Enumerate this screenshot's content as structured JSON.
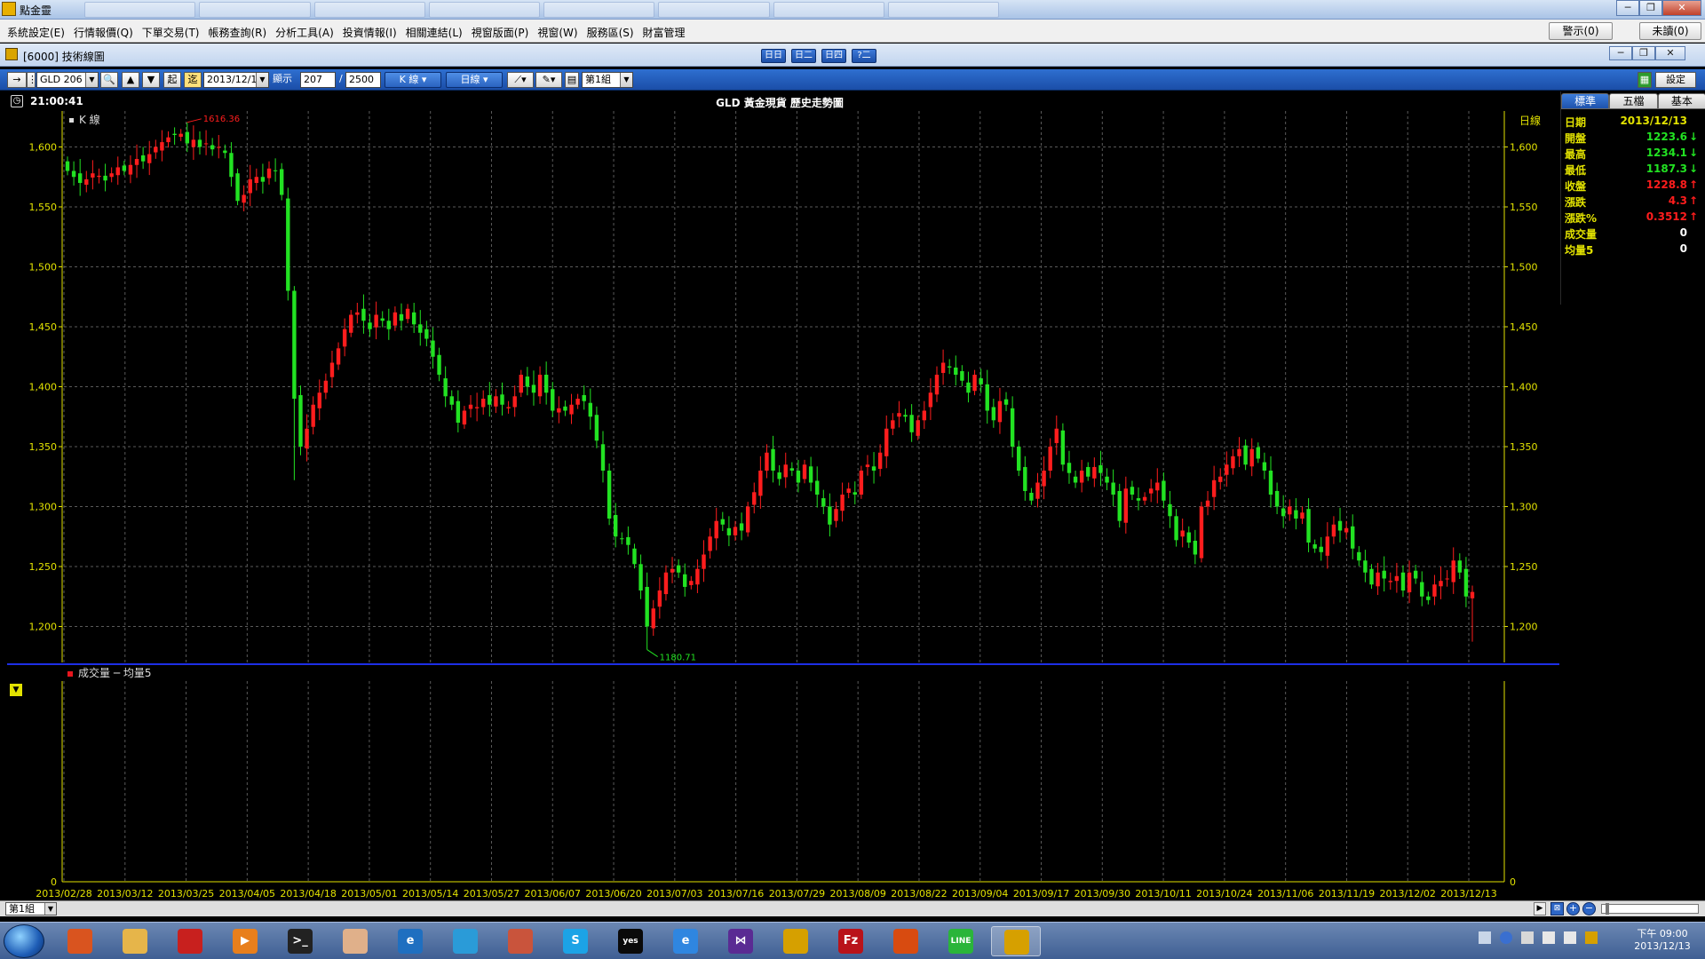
{
  "app": {
    "title": "點金靈",
    "window_buttons": [
      "─",
      "❐",
      "✕"
    ]
  },
  "menu": {
    "items": [
      "系統設定(E)",
      "行情報價(Q)",
      "下單交易(T)",
      "帳務查詢(R)",
      "分析工具(A)",
      "投資情報(I)",
      "相關連結(L)",
      "視窗版面(P)",
      "視窗(W)",
      "服務區(S)",
      "財富管理"
    ],
    "alert_button": "警示(0)",
    "unread_button": "未讀(0)"
  },
  "child_window": {
    "title": "[6000] 技術線圖",
    "mid_buttons": [
      "日日",
      "日二",
      "日四",
      "?二"
    ]
  },
  "toolbar": {
    "symbol": "GLD 206",
    "start_label": "起",
    "end_label": "迄",
    "date": "2013/12/13",
    "show_label": "顯示",
    "show_count": "207",
    "separator": "/",
    "total_count": "2500",
    "chart_type": "K 線",
    "period": "日線",
    "group": "第1組",
    "settings": "設定"
  },
  "chart_header": {
    "clock": "21:00:41",
    "title": "GLD 黃金現貨  歷史走勢圖",
    "legend": "K 線",
    "period_label": "日線",
    "high_label": "1616.36",
    "low_label": "1180.71"
  },
  "volume": {
    "legend": "成交量 ─  均量5",
    "zero_label": "0",
    "group": "第1組"
  },
  "info_panel": {
    "tabs": [
      "標準",
      "五檔",
      "基本"
    ],
    "rows": [
      {
        "key": "日期",
        "value": "2013/12/13",
        "arrow": "",
        "color": "yellow"
      },
      {
        "key": "開盤",
        "value": "1223.6",
        "arrow": "↓",
        "color": "green"
      },
      {
        "key": "最高",
        "value": "1234.1",
        "arrow": "↓",
        "color": "green"
      },
      {
        "key": "最低",
        "value": "1187.3",
        "arrow": "↓",
        "color": "green"
      },
      {
        "key": "收盤",
        "value": "1228.8",
        "arrow": "↑",
        "color": "red"
      },
      {
        "key": "漲跌",
        "value": "4.3",
        "arrow": "↑",
        "color": "red"
      },
      {
        "key": "漲跌%",
        "value": "0.3512",
        "arrow": "↑",
        "color": "red"
      },
      {
        "key": "成交量",
        "value": "0",
        "arrow": "",
        "color": "white"
      },
      {
        "key": "均量5",
        "value": "0",
        "arrow": "",
        "color": "white"
      }
    ]
  },
  "taskbar": {
    "time": "下午 09:00",
    "date": "2013/12/13",
    "icons": [
      "firefox-icon",
      "explorer-icon",
      "rocket-icon",
      "media-player-icon",
      "cmd-icon",
      "mascot-icon",
      "browser-e-icon",
      "notebook-icon",
      "cartoon-icon",
      "skype-icon",
      "yes-win-icon",
      "ie-icon",
      "visual-studio-icon",
      "stock-app-icon",
      "filezilla-icon",
      "package-icon",
      "line-icon",
      "gold-app-icon"
    ],
    "icon_glyphs": [
      "",
      "",
      "",
      "▶",
      ">_",
      "",
      "e",
      "",
      "",
      "S",
      "yes",
      "e",
      "⋈",
      "",
      "Fz",
      "",
      "LINE",
      ""
    ],
    "icon_colors": [
      "#d9541f",
      "#e6b54a",
      "#c8201e",
      "#e87f1c",
      "#222222",
      "#e0b08a",
      "#1f6fc0",
      "#2a9bd8",
      "#c9543c",
      "#1ca3e6",
      "#0a0a0a",
      "#2f86e0",
      "#5a2b93",
      "#d6a000",
      "#b9131a",
      "#d84b10",
      "#2ab53a",
      "#d6a000"
    ]
  },
  "colors": {
    "up": "#ff1d1d",
    "down": "#22e222",
    "axis": "#e2e200",
    "grid": "#5a5a5a",
    "separator": "#1d2fe6"
  },
  "chart_data": {
    "type": "candlestick",
    "title": "GLD 黃金現貨  歷史走勢圖",
    "ylim": [
      1170,
      1630
    ],
    "y_ticks": [
      1200,
      1250,
      1300,
      1350,
      1400,
      1450,
      1500,
      1550,
      1600
    ],
    "y_tick_labels": [
      "1,200",
      "1,250",
      "1,300",
      "1,350",
      "1,400",
      "1,450",
      "1,500",
      "1,550",
      "1,600"
    ],
    "x_ticks": [
      "2013/02/28",
      "2013/03/12",
      "2013/03/25",
      "2013/04/05",
      "2013/04/18",
      "2013/05/01",
      "2013/05/14",
      "2013/05/27",
      "2013/06/07",
      "2013/06/20",
      "2013/07/03",
      "2013/07/16",
      "2013/07/29",
      "2013/08/09",
      "2013/08/22",
      "2013/09/04",
      "2013/09/17",
      "2013/09/30",
      "2013/10/11",
      "2013/10/24",
      "2013/11/06",
      "2013/11/19",
      "2013/12/02",
      "2013/12/13"
    ],
    "volume_ylim": [
      0,
      1
    ],
    "volume_y_ticks": [
      0
    ],
    "closes": [
      1580,
      1575,
      1570,
      1573,
      1578,
      1576,
      1572,
      1578,
      1583,
      1580,
      1585,
      1590,
      1588,
      1594,
      1600,
      1604,
      1608,
      1610,
      1611,
      1603,
      1606,
      1600,
      1603,
      1598,
      1600,
      1595,
      1575,
      1555,
      1560,
      1573,
      1575,
      1571,
      1582,
      1580,
      1560,
      1480,
      1390,
      1350,
      1365,
      1385,
      1395,
      1405,
      1420,
      1432,
      1448,
      1460,
      1462,
      1455,
      1448,
      1460,
      1455,
      1448,
      1462,
      1455,
      1465,
      1452,
      1445,
      1440,
      1425,
      1410,
      1392,
      1385,
      1370,
      1380,
      1385,
      1383,
      1390,
      1385,
      1392,
      1385,
      1383,
      1392,
      1410,
      1400,
      1395,
      1410,
      1395,
      1380,
      1382,
      1380,
      1385,
      1390,
      1388,
      1375,
      1355,
      1330,
      1290,
      1275,
      1273,
      1268,
      1252,
      1230,
      1200,
      1215,
      1230,
      1245,
      1248,
      1245,
      1233,
      1238,
      1248,
      1260,
      1275,
      1288,
      1285,
      1276,
      1283,
      1280,
      1300,
      1312,
      1330,
      1345,
      1330,
      1323,
      1335,
      1330,
      1320,
      1335,
      1320,
      1310,
      1300,
      1285,
      1298,
      1310,
      1315,
      1310,
      1330,
      1335,
      1330,
      1345,
      1365,
      1372,
      1378,
      1375,
      1362,
      1372,
      1380,
      1395,
      1410,
      1420,
      1416,
      1410,
      1405,
      1395,
      1410,
      1402,
      1380,
      1372,
      1388,
      1385,
      1350,
      1330,
      1313,
      1305,
      1320,
      1330,
      1350,
      1365,
      1335,
      1328,
      1320,
      1330,
      1325,
      1333,
      1328,
      1320,
      1310,
      1288,
      1315,
      1310,
      1305,
      1308,
      1315,
      1320,
      1305,
      1292,
      1272,
      1280,
      1270,
      1260,
      1300,
      1305,
      1322,
      1325,
      1335,
      1342,
      1348,
      1335,
      1348,
      1340,
      1330,
      1310,
      1300,
      1292,
      1300,
      1290,
      1295,
      1270,
      1265,
      1262,
      1275,
      1285,
      1280,
      1282,
      1265,
      1255,
      1245,
      1235,
      1245,
      1240,
      1238,
      1242,
      1230,
      1245,
      1240,
      1225,
      1222,
      1235,
      1238,
      1240,
      1255,
      1245,
      1225,
      1228.8
    ]
  }
}
